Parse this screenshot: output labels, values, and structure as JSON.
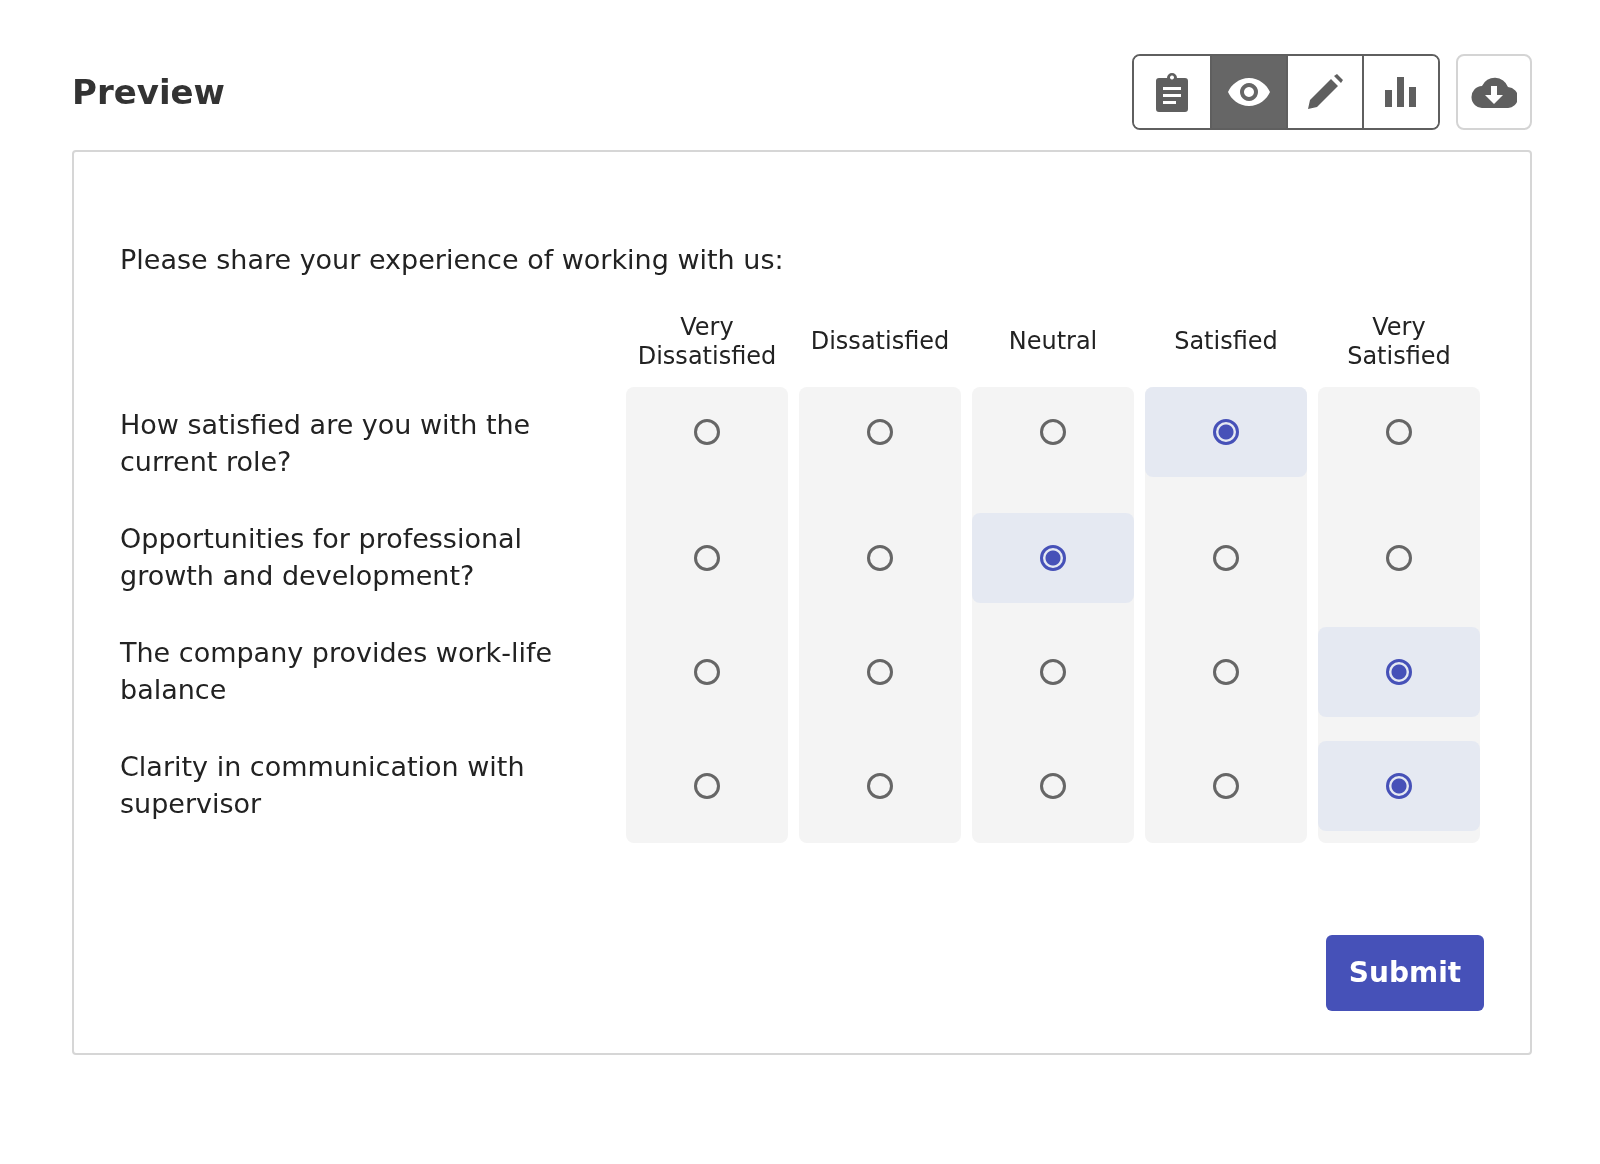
{
  "header": {
    "title": "Preview"
  },
  "view_toolbar": [
    {
      "kind": "clipboard",
      "selected": false
    },
    {
      "kind": "eye",
      "selected": true
    },
    {
      "kind": "pencil",
      "selected": false
    },
    {
      "kind": "chart",
      "selected": false
    }
  ],
  "download_button": {
    "kind": "cloud-download"
  },
  "survey": {
    "question": "Please share your experience of working with us:",
    "columns": [
      "Very Dissatisfied",
      "Dissatisfied",
      "Neutral",
      "Satisfied",
      "Very Satisfied"
    ],
    "rows": [
      {
        "label": "How satisfied are you with the current role?",
        "choices": [
          {
            "selected": false
          },
          {
            "selected": false
          },
          {
            "selected": false
          },
          {
            "selected": true
          },
          {
            "selected": false
          }
        ]
      },
      {
        "label": "Opportunities for professional growth and development?",
        "choices": [
          {
            "selected": false
          },
          {
            "selected": false
          },
          {
            "selected": true
          },
          {
            "selected": false
          },
          {
            "selected": false
          }
        ]
      },
      {
        "label": "The company provides work-life balance",
        "choices": [
          {
            "selected": false
          },
          {
            "selected": false
          },
          {
            "selected": false
          },
          {
            "selected": false
          },
          {
            "selected": true
          }
        ]
      },
      {
        "label": "Clarity in communication with supervisor",
        "choices": [
          {
            "selected": false
          },
          {
            "selected": false
          },
          {
            "selected": false
          },
          {
            "selected": false
          },
          {
            "selected": true
          }
        ]
      }
    ],
    "submit_button": "Submit"
  }
}
